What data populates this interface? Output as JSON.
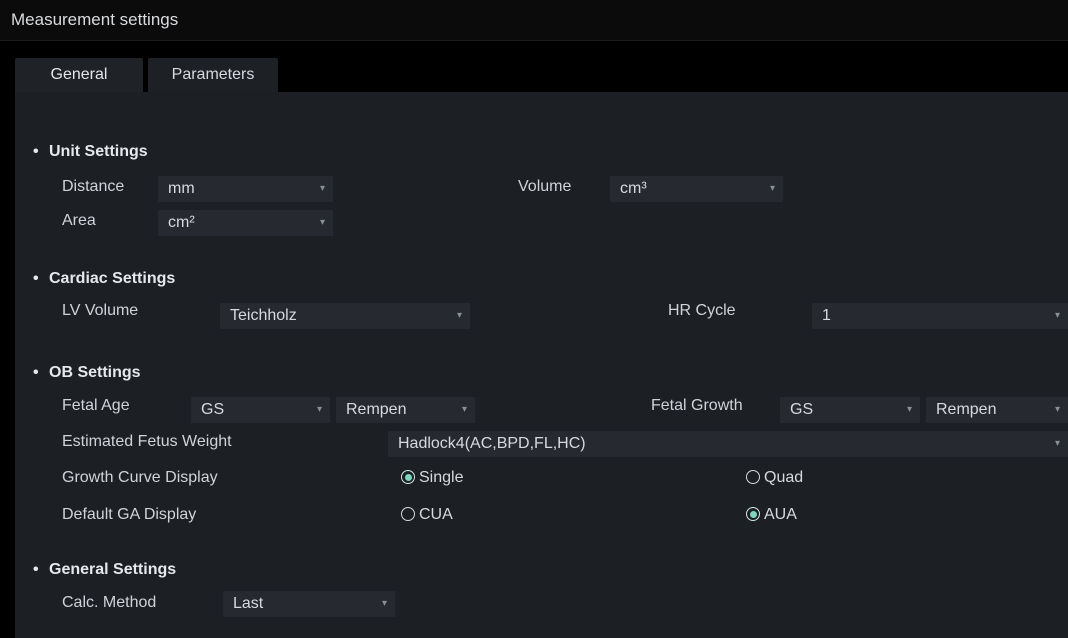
{
  "window": {
    "title": "Measurement settings"
  },
  "tabs": [
    {
      "label": "General"
    },
    {
      "label": "Parameters"
    }
  ],
  "unit_settings": {
    "heading": "Unit Settings",
    "distance_label": "Distance",
    "distance_value": "mm",
    "area_label": "Area",
    "area_value": "cm²",
    "volume_label": "Volume",
    "volume_value": "cm³"
  },
  "cardiac_settings": {
    "heading": "Cardiac Settings",
    "lv_volume_label": "LV Volume",
    "lv_volume_value": "Teichholz",
    "hr_cycle_label": "HR Cycle",
    "hr_cycle_value": "1"
  },
  "ob_settings": {
    "heading": "OB Settings",
    "fetal_age_label": "Fetal Age",
    "fetal_age_value1": "GS",
    "fetal_age_value2": "Rempen",
    "fetal_growth_label": "Fetal Growth",
    "fetal_growth_value1": "GS",
    "fetal_growth_value2": "Rempen",
    "efw_label": "Estimated Fetus Weight",
    "efw_value": "Hadlock4(AC,BPD,FL,HC)",
    "growth_curve_label": "Growth Curve Display",
    "growth_curve_options": [
      "Single",
      "Quad"
    ],
    "growth_curve_selected": "Single",
    "default_ga_label": "Default GA Display",
    "default_ga_options": [
      "CUA",
      "AUA"
    ],
    "default_ga_selected": "AUA"
  },
  "general_settings": {
    "heading": "General Settings",
    "calc_method_label": "Calc. Method",
    "calc_method_value": "Last"
  },
  "colors": {
    "background": "#000000",
    "panel": "#1c1f24",
    "field": "#262a30",
    "radio_accent": "#7fd6bd"
  }
}
